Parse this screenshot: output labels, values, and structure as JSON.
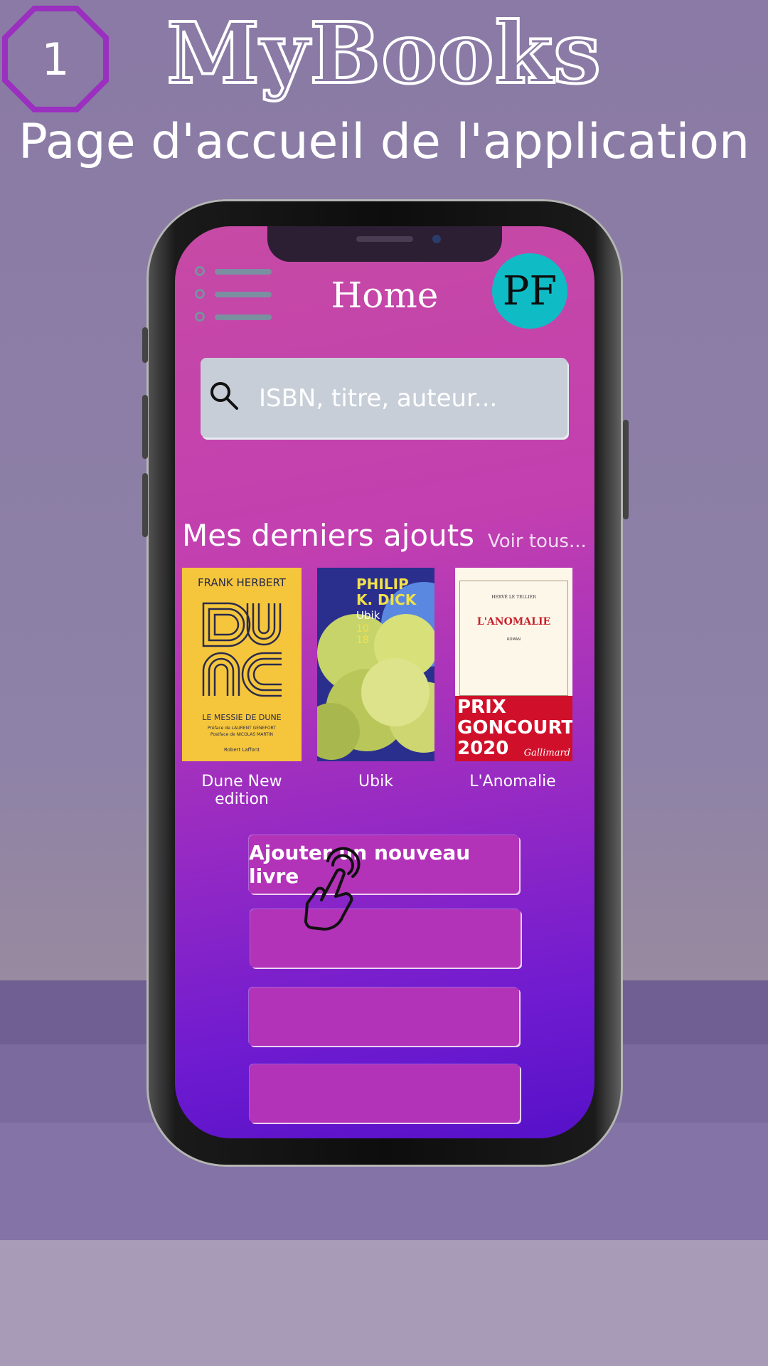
{
  "step": {
    "number": "1"
  },
  "header": {
    "app_name": "MyBooks",
    "subtitle": "Page d'accueil de l'application"
  },
  "screen": {
    "title": "Home",
    "avatar_initials": "PF",
    "menu_icon": "hamburger-menu-icon",
    "search": {
      "placeholder": "ISBN, titre, auteur...",
      "icon": "search-icon"
    },
    "recent": {
      "title": "Mes derniers ajouts",
      "see_all": "Voir tous...",
      "books": [
        {
          "label": "Dune New edition",
          "cover": {
            "author": "FRANK HERBERT",
            "title": "LE MESSIE DE DUNE",
            "line1": "Préface de LAURENT GENEFORT",
            "line2": "Postface de NICOLAS MARTIN",
            "publisher": "Robert Laffont",
            "bg": "#f5c63c"
          }
        },
        {
          "label": "Ubik",
          "cover": {
            "author": "PHILIP K. DICK",
            "title": "Ubik",
            "publisher_number": "10 18",
            "bg": "#2a2f8e"
          }
        },
        {
          "label": "L'Anomalie",
          "cover": {
            "author": "HERVÉ LE TELLIER",
            "title": "L'ANOMALIE",
            "genre": "ROMAN",
            "band": "PRIX GONCOURT 2020",
            "publisher": "Gallimard",
            "bg": "#fdf7ea"
          }
        }
      ]
    },
    "buttons": [
      {
        "label": "Ajouter un nouveau livre"
      },
      {
        "label": ""
      },
      {
        "label": ""
      },
      {
        "label": ""
      }
    ],
    "cursor_icon": "tap-hand-icon"
  },
  "colors": {
    "accent": "#b232b8",
    "avatar": "#0fbcc6",
    "search_bg": "#c7ced8"
  }
}
